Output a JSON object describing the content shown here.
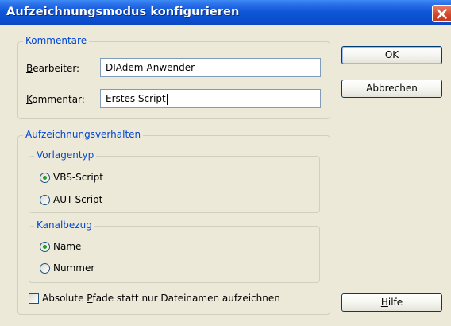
{
  "window": {
    "title": "Aufzeichnungsmodus konfigurieren"
  },
  "kommentare": {
    "legend": "Kommentare",
    "bearbeiter_label_pre": "B",
    "bearbeiter_label_rest": "earbeiter:",
    "bearbeiter_value": "DIAdem-Anwender",
    "kommentar_label_pre": "K",
    "kommentar_label_rest": "ommentar:",
    "kommentar_value": "Erstes Script"
  },
  "verhalten": {
    "legend": "Aufzeichnungsverhalten",
    "vorlagentyp": {
      "legend": "Vorlagentyp",
      "options": [
        "VBS-Script",
        "AUT-Script"
      ],
      "selected": "VBS-Script"
    },
    "kanalbezug": {
      "legend": "Kanalbezug",
      "options": [
        "Name",
        "Nummer"
      ],
      "selected": "Name"
    }
  },
  "checkbox": {
    "label_pre": "Absolute ",
    "label_u": "P",
    "label_post": "fade statt nur Dateinamen aufzeichnen",
    "checked": false
  },
  "buttons": {
    "ok": "OK",
    "cancel": "Abbrechen",
    "help_u": "H",
    "help_rest": "ilfe"
  },
  "colors": {
    "accent": "#0046d5",
    "titlebar": "#0a4fd0",
    "radio_dot": "#21a121"
  }
}
